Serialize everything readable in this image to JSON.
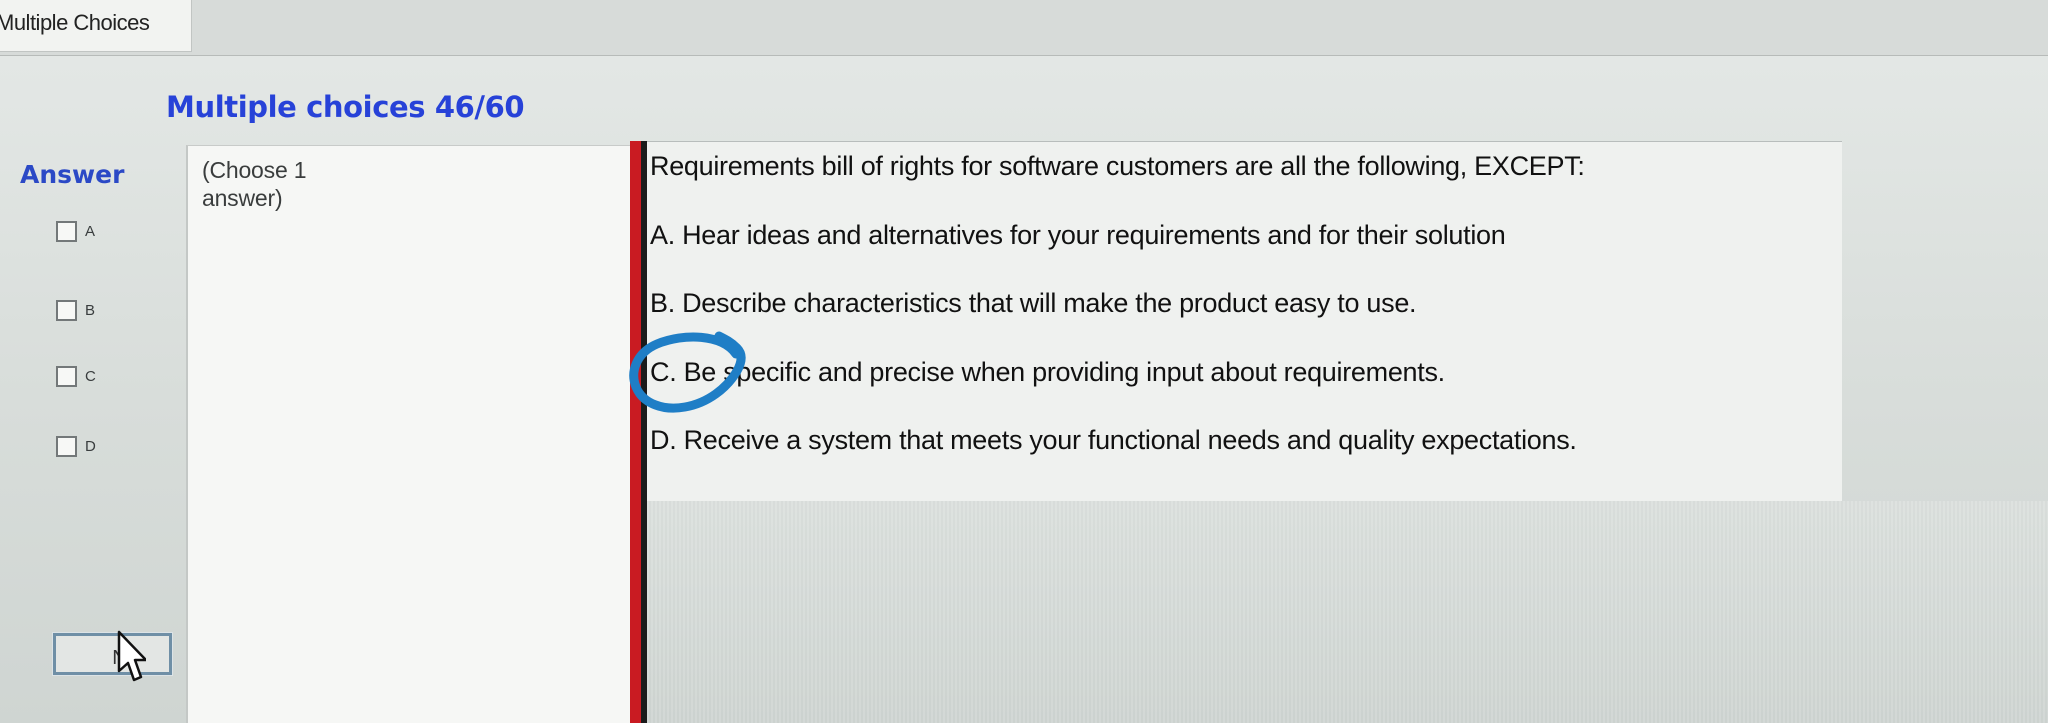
{
  "tab": {
    "label": "Multiple Choices"
  },
  "header": {
    "title": "Multiple choices 46/60"
  },
  "answer": {
    "heading": "Answer",
    "instruction": "(Choose 1 answer)",
    "choices": [
      {
        "label": "A"
      },
      {
        "label": "B"
      },
      {
        "label": "C"
      },
      {
        "label": "D"
      }
    ],
    "next_button_label": "Ne"
  },
  "question": {
    "text": "Requirements bill of rights for software customers are all the following, EXCEPT:",
    "options": [
      {
        "text": "A. Hear ideas and alternatives for your requirements and for their solution"
      },
      {
        "text": "B. Describe characteristics that will make the product easy to use."
      },
      {
        "text": "C. Be specific and precise when providing input about requirements."
      },
      {
        "text": "D. Receive a system that meets your functional needs and quality expectations."
      }
    ]
  },
  "colors": {
    "title": "#2742d8",
    "answer_heading": "#2b49c6",
    "divider": "#c91b22",
    "annotation": "#1f7ec6"
  },
  "icons": {
    "cursor": "pointer-cursor-icon",
    "annotation": "hand-drawn-circle-mark"
  }
}
